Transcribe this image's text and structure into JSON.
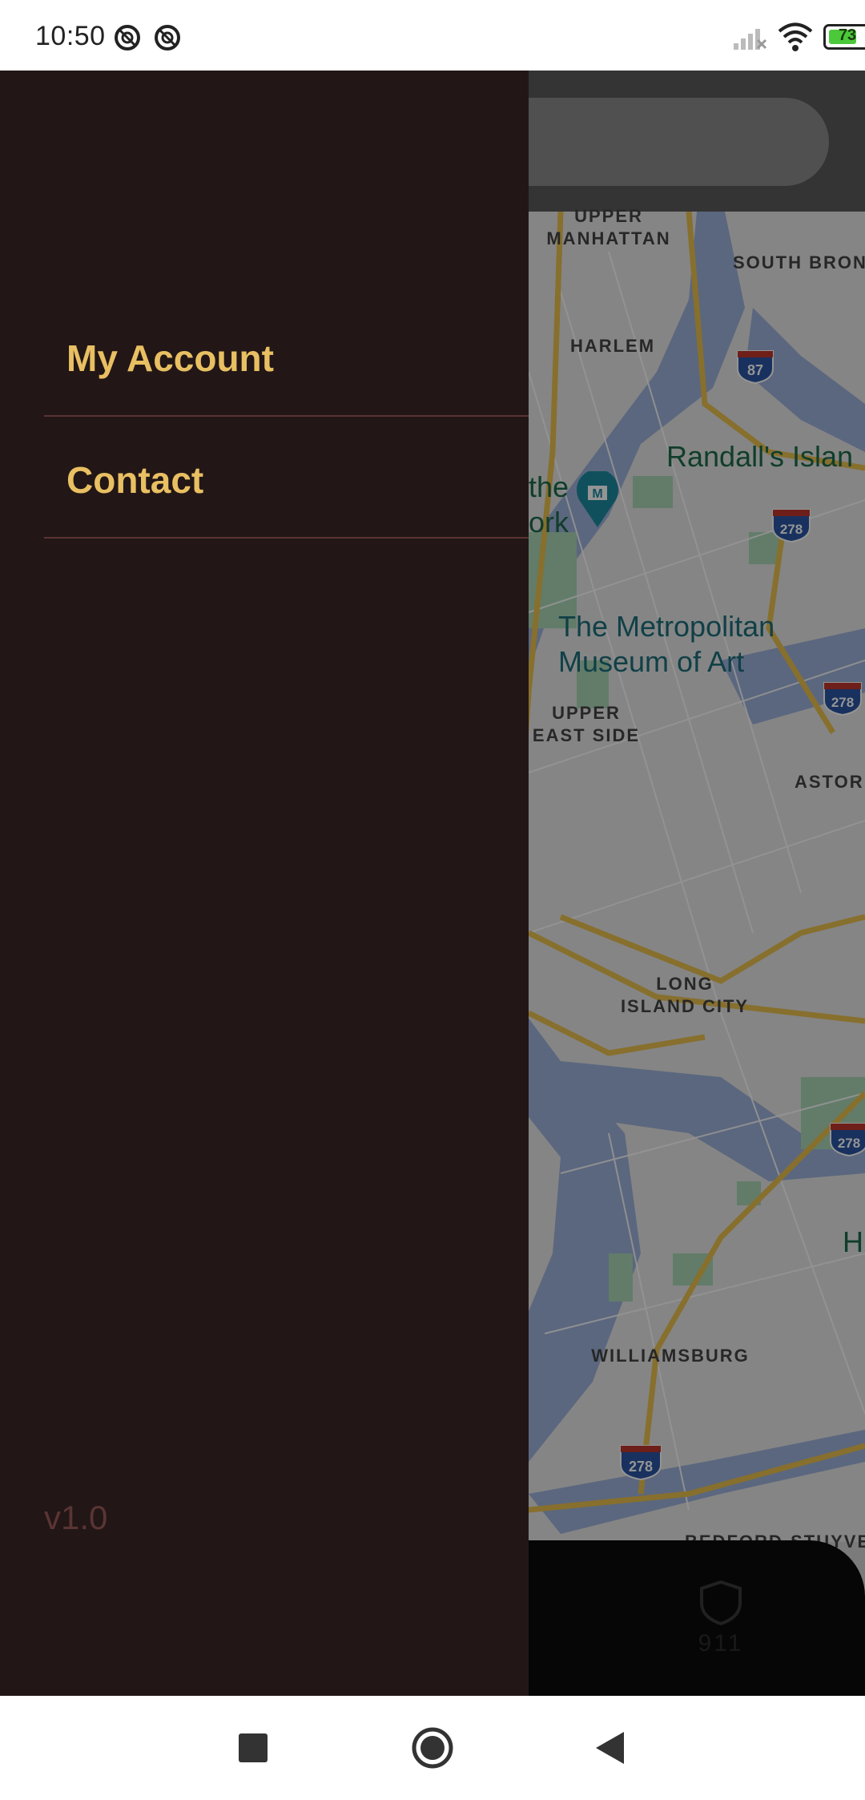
{
  "status_bar": {
    "time": "10:50",
    "battery_level": "73",
    "battery_fraction": 0.73,
    "icons": [
      "app-notification-icon",
      "app-notification-icon",
      "signal-icon",
      "wifi-icon",
      "battery-icon"
    ]
  },
  "drawer": {
    "items": [
      {
        "label": "My Account",
        "icon": "none"
      },
      {
        "label": "Contact",
        "icon": "none"
      }
    ],
    "version": "v1.0",
    "colors": {
      "background": "#221616",
      "accent": "#e8bf62",
      "divider": "#5a3434"
    }
  },
  "map": {
    "labels": {
      "upper_manhattan": "UPPER MANHATTAN",
      "south_bronx": "SOUTH BRON",
      "harlem": "HARLEM",
      "randalls_island": "Randall's Islan",
      "the_york": "the\nork",
      "met_museum": "The Metropolitan\nMuseum of Art",
      "upper_east_side": "UPPER\nEAST SIDE",
      "astoria": "ASTOR",
      "long_island_city": "LONG\nISLAND CITY",
      "williamsburg": "WILLIAMSBURG",
      "bedford": "BEDFORD-STUYVE",
      "h_label": "H"
    },
    "shields": [
      "87",
      "278",
      "278",
      "278",
      "278"
    ]
  },
  "bottom_bar": {
    "label_911": "911"
  },
  "nav_bar": {
    "buttons": [
      "recents-square-icon",
      "home-circle-icon",
      "back-triangle-icon"
    ]
  }
}
